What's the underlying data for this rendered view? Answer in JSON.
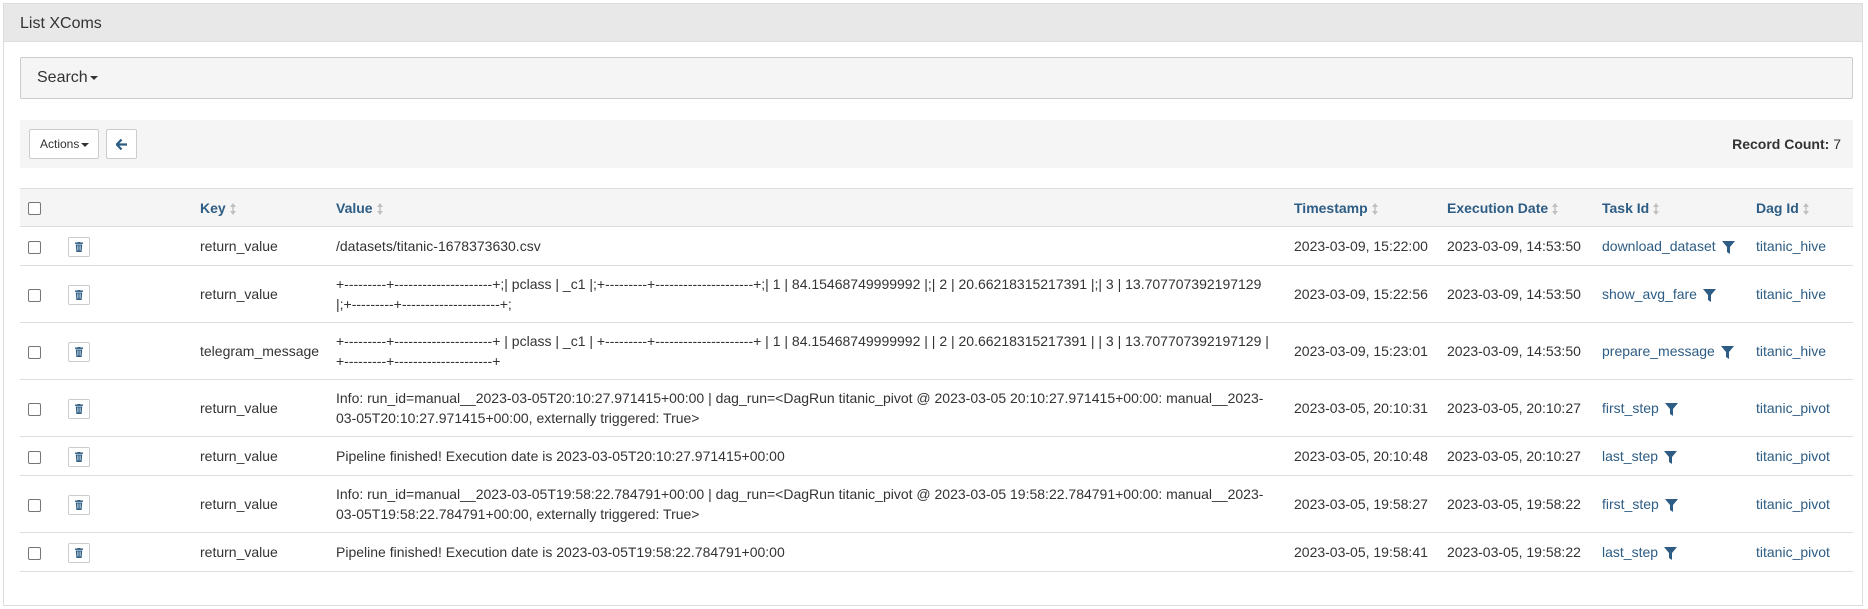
{
  "page": {
    "title": "List XComs"
  },
  "search": {
    "label": "Search"
  },
  "toolbar": {
    "actions_label": "Actions",
    "record_count_label": "Record Count:",
    "record_count": "7"
  },
  "table": {
    "columns": {
      "key": "Key",
      "value": "Value",
      "timestamp": "Timestamp",
      "execution_date": "Execution Date",
      "task_id": "Task Id",
      "dag_id": "Dag Id"
    },
    "rows": [
      {
        "key": "return_value",
        "value": "/datasets/titanic-1678373630.csv",
        "timestamp": "2023-03-09, 15:22:00",
        "execution_date": "2023-03-09, 14:53:50",
        "task_id": "download_dataset",
        "dag_id": "titanic_hive"
      },
      {
        "key": "return_value",
        "value": "+---------+---------------------+;| pclass | _c1 |;+---------+---------------------+;| 1 | 84.15468749999992 |;| 2 | 20.66218315217391 |;| 3 | 13.707707392197129 |;+---------+---------------------+;",
        "timestamp": "2023-03-09, 15:22:56",
        "execution_date": "2023-03-09, 14:53:50",
        "task_id": "show_avg_fare",
        "dag_id": "titanic_hive"
      },
      {
        "key": "telegram_message",
        "value": "+---------+---------------------+ | pclass | _c1 | +---------+---------------------+ | 1 | 84.15468749999992 | | 2 | 20.66218315217391 | | 3 | 13.707707392197129 | +---------+---------------------+",
        "timestamp": "2023-03-09, 15:23:01",
        "execution_date": "2023-03-09, 14:53:50",
        "task_id": "prepare_message",
        "dag_id": "titanic_hive"
      },
      {
        "key": "return_value",
        "value": "Info: run_id=manual__2023-03-05T20:10:27.971415+00:00 | dag_run=<DagRun titanic_pivot @ 2023-03-05 20:10:27.971415+00:00: manual__2023-03-05T20:10:27.971415+00:00, externally triggered: True>",
        "timestamp": "2023-03-05, 20:10:31",
        "execution_date": "2023-03-05, 20:10:27",
        "task_id": "first_step",
        "dag_id": "titanic_pivot"
      },
      {
        "key": "return_value",
        "value": "Pipeline finished! Execution date is 2023-03-05T20:10:27.971415+00:00",
        "timestamp": "2023-03-05, 20:10:48",
        "execution_date": "2023-03-05, 20:10:27",
        "task_id": "last_step",
        "dag_id": "titanic_pivot"
      },
      {
        "key": "return_value",
        "value": "Info: run_id=manual__2023-03-05T19:58:22.784791+00:00 | dag_run=<DagRun titanic_pivot @ 2023-03-05 19:58:22.784791+00:00: manual__2023-03-05T19:58:22.784791+00:00, externally triggered: True>",
        "timestamp": "2023-03-05, 19:58:27",
        "execution_date": "2023-03-05, 19:58:22",
        "task_id": "first_step",
        "dag_id": "titanic_pivot"
      },
      {
        "key": "return_value",
        "value": "Pipeline finished! Execution date is 2023-03-05T19:58:22.784791+00:00",
        "timestamp": "2023-03-05, 19:58:41",
        "execution_date": "2023-03-05, 19:58:22",
        "task_id": "last_step",
        "dag_id": "titanic_pivot"
      }
    ]
  },
  "colors": {
    "link": "#2d5c84",
    "header_bg": "#e8e8e8",
    "toolbar_bg": "#f5f5f5"
  },
  "icons": {
    "delete": "trash-icon",
    "filter": "filter-icon",
    "back": "arrow-left-icon",
    "sort": "sort-icon"
  }
}
